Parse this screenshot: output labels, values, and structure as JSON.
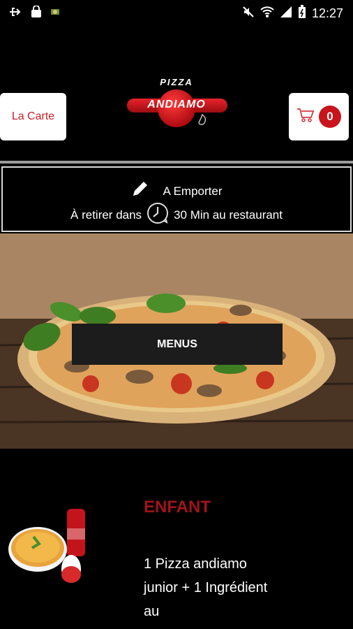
{
  "status_bar": {
    "time": "12:27",
    "icons": [
      "usb-icon",
      "bag-icon",
      "app-icon",
      "mute-icon",
      "wifi-icon",
      "signal-icon",
      "battery-icon"
    ]
  },
  "header": {
    "carte_button": "La Carte",
    "cart_count": "0",
    "logo": {
      "top": "PIZZA",
      "main": "ANDIAMO"
    }
  },
  "info": {
    "mode": "A Emporter",
    "pickup_prefix": "À retirer dans",
    "pickup_time": "30 Min au restaurant"
  },
  "hero": {
    "button": "MENUS"
  },
  "product": {
    "title": "ENFANT",
    "description": "1 Pizza andiamo junior + 1 Ingrédient au"
  },
  "colors": {
    "accent": "#c8141c",
    "title_red": "#a0141a",
    "background": "#000000"
  }
}
